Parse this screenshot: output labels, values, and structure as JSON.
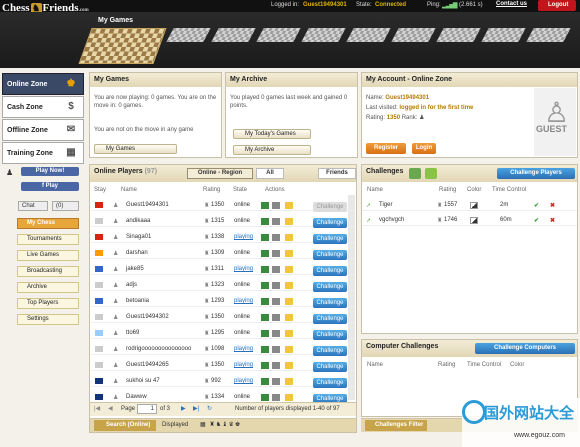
{
  "topbar": {
    "logged_in_label": "Logged in:",
    "user": "Guest19494301",
    "state_label": "State:",
    "state": "Connected",
    "ping_label": "Ping:",
    "ping": "(2.661 s)",
    "contact": "Contact us",
    "logout": "Logout"
  },
  "logo": {
    "left": "Chess",
    "right": "Friends",
    "com": ".com"
  },
  "header": {
    "tab": "My Games"
  },
  "nav": [
    {
      "label": "Online Zone",
      "icon": "chess-king-icon"
    },
    {
      "label": "Cash Zone",
      "icon": "dollar-icon"
    },
    {
      "label": "Offline Zone",
      "icon": "envelope-icon"
    },
    {
      "label": "Training Zone",
      "icon": "chessboard-icon"
    }
  ],
  "side": {
    "play_now": "Play Now!",
    "facebook": "f Play",
    "chat": "Chat",
    "count": "(0)",
    "items": [
      "My Chess",
      "Tournaments",
      "Live Games",
      "Broadcasting",
      "Archive",
      "Top Players",
      "Settings"
    ]
  },
  "mygames": {
    "title": "My Games",
    "text1": "You are now playing: 0 games. You are on the move in: 0 games.",
    "text2": "You are not on the move in any game",
    "button": "My Games"
  },
  "archive": {
    "title": "My Archive",
    "text1": "You played 0 games last week and gained 0 points.",
    "button1": "My Today's Games",
    "button2": "My Archive"
  },
  "account": {
    "title": "My Account - Online Zone",
    "name_label": "Name:",
    "name": "Guest19494301",
    "visit_label": "Last visited:",
    "visit": "logged in for the first time",
    "rating_label": "Rating:",
    "rating": "1350",
    "rank_label": "Rank:",
    "register": "Register",
    "login": "Login",
    "guest": "GUEST"
  },
  "players": {
    "title": "Online Players",
    "count": "(97)",
    "tabs": [
      "Online - Region",
      "All",
      "Friends"
    ],
    "cols": [
      "Stay",
      "Name",
      "Rating",
      "State",
      "Actions"
    ],
    "rows": [
      {
        "name": "Guest19494301",
        "rating": "1350",
        "state": "online",
        "flag": "#d21",
        "dis": true
      },
      {
        "name": "andikaaa",
        "rating": "1315",
        "state": "online",
        "flag": "#ccc",
        "dis": false
      },
      {
        "name": "Sinaga01",
        "rating": "1338",
        "state": "playing",
        "flag": "#d21",
        "dis": false
      },
      {
        "name": "darshan",
        "rating": "1309",
        "state": "online",
        "flag": "#f90",
        "dis": false
      },
      {
        "name": "jake85",
        "rating": "1311",
        "state": "playing",
        "flag": "#36c",
        "dis": false
      },
      {
        "name": "adjs",
        "rating": "1323",
        "state": "online",
        "flag": "#ccc",
        "dis": false
      },
      {
        "name": "betoania",
        "rating": "1293",
        "state": "playing",
        "flag": "#36c",
        "dis": false
      },
      {
        "name": "Guest19494302",
        "rating": "1350",
        "state": "online",
        "flag": "#ccc",
        "dis": false
      },
      {
        "name": "tto69",
        "rating": "1295",
        "state": "online",
        "flag": "#9cf",
        "dis": false
      },
      {
        "name": "rodrigooooooooooooooo",
        "rating": "1098",
        "state": "playing",
        "flag": "#ccc",
        "dis": false
      },
      {
        "name": "Guest19494265",
        "rating": "1350",
        "state": "playing",
        "flag": "#ccc",
        "dis": false
      },
      {
        "name": "sukhoi su 47",
        "rating": "992",
        "state": "playing",
        "flag": "#137",
        "dis": false
      },
      {
        "name": "Dawww",
        "rating": "1334",
        "state": "online",
        "flag": "#137",
        "dis": false
      }
    ],
    "challenge": "Challenge",
    "page_label": "Page",
    "page": "1",
    "of": "of 3",
    "footer_count": "Number of players displayed 1-40 of 97",
    "search": "Search (Online)",
    "displayed": "Displayed"
  },
  "challenges": {
    "title": "Challenges",
    "button": "Challenge Players",
    "cols": [
      "Name",
      "Rating",
      "Color",
      "Time Control"
    ],
    "rows": [
      {
        "name": "Tiger",
        "rating": "1557",
        "time": "2m"
      },
      {
        "name": "vgchvgch",
        "rating": "1746",
        "time": "60m"
      }
    ]
  },
  "computer": {
    "title": "Computer Challenges",
    "button": "Challenge Computers",
    "cols": [
      "Name",
      "Rating",
      "Time Control",
      "Color"
    ],
    "filter": "Challenges Filter"
  },
  "stamp": {
    "text": "国外网站大全",
    "url": "www.egouz.com"
  }
}
